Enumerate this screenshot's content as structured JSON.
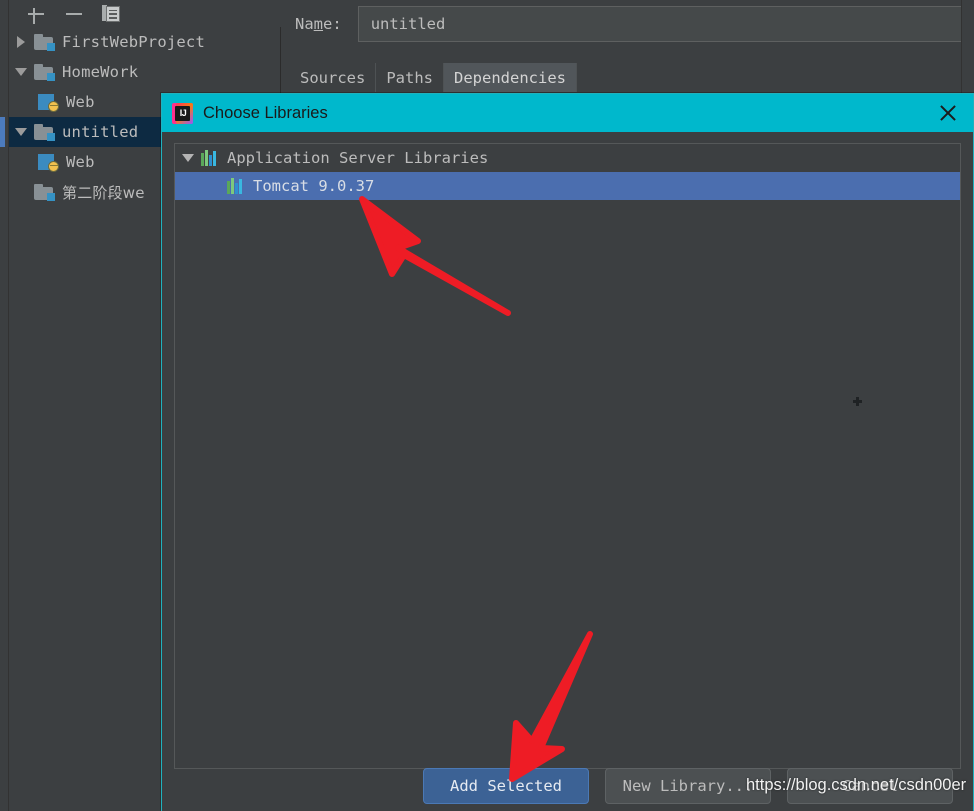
{
  "toolbar": {
    "add_label": "+",
    "remove_label": "−",
    "copy_label": "Copy",
    "icons": [
      "plus-icon",
      "minus-icon",
      "copy-icon"
    ]
  },
  "project_tree": {
    "items": [
      {
        "label": "FirstWebProject",
        "icon": "folder-module-icon",
        "expander": "collapsed",
        "indent": 0,
        "selected": false
      },
      {
        "label": "HomeWork",
        "icon": "folder-module-icon",
        "expander": "expanded",
        "indent": 0,
        "selected": false
      },
      {
        "label": "Web",
        "icon": "web-module-icon",
        "expander": "none",
        "indent": 1,
        "selected": false
      },
      {
        "label": "untitled",
        "icon": "folder-module-icon",
        "expander": "expanded",
        "indent": 0,
        "selected": true
      },
      {
        "label": "Web",
        "icon": "web-module-icon",
        "expander": "none",
        "indent": 1,
        "selected": false
      },
      {
        "label": "第二阶段we",
        "icon": "folder-module-icon",
        "expander": "none",
        "indent": 0,
        "selected": false
      }
    ]
  },
  "module_form": {
    "name_label": "Name:",
    "name_value": "untitled",
    "tabs": [
      {
        "label": "Sources",
        "active": false
      },
      {
        "label": "Paths",
        "active": false
      },
      {
        "label": "Dependencies",
        "active": true
      }
    ]
  },
  "dialog": {
    "title": "Choose Libraries",
    "title_icon": "intellij-idea-logo-icon",
    "title_bar_color": "#00b8cc",
    "close_label": "×",
    "tree": [
      {
        "label": "Application Server Libraries",
        "icon": "library-icon",
        "expander": "expanded",
        "indent": 0,
        "selected": false
      },
      {
        "label": "Tomcat 9.0.37",
        "icon": "library-icon",
        "expander": "none",
        "indent": 1,
        "selected": true
      }
    ],
    "buttons": [
      {
        "label": "Add Selected",
        "primary": true
      },
      {
        "label": "New Library...",
        "primary": false
      },
      {
        "label": "Cancel",
        "primary": false
      }
    ],
    "selection_color": "#4b6eaf"
  },
  "annotations": {
    "watermark": "https://blog.csdn.net/csdn00er",
    "arrow_color": "#ee1c25",
    "arrows": [
      {
        "name": "arrow-to-tomcat-row",
        "points_to": "Tomcat 9.0.37"
      },
      {
        "name": "arrow-to-add-selected",
        "points_to": "Add Selected"
      }
    ],
    "cursor": "crosshair-cursor"
  }
}
